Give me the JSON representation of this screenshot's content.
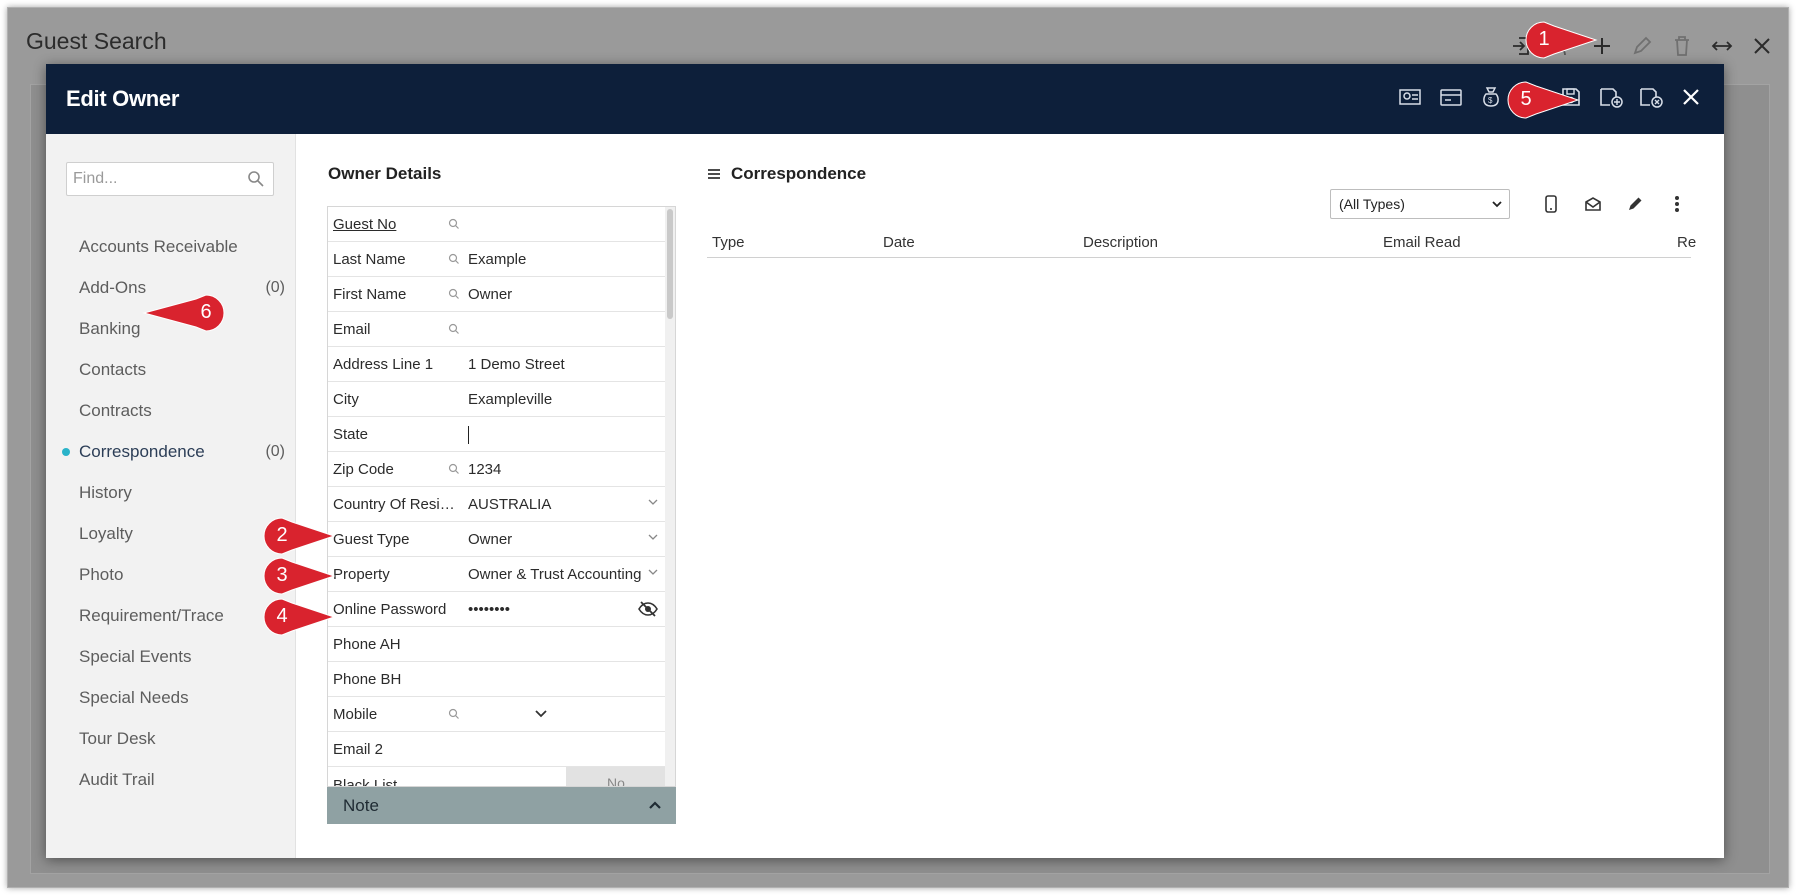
{
  "window": {
    "title": "Guest Search",
    "toolbar_icons": [
      "sign-in-icon",
      "group-icon",
      "plus-icon",
      "pencil-icon",
      "trash-icon",
      "resize-icon",
      "close-icon"
    ]
  },
  "modal": {
    "title": "Edit Owner",
    "header_icons": [
      "guest-icon",
      "card-icon",
      "money-bag-icon",
      "star-icon",
      "save-icon",
      "save-new-icon",
      "save-close-icon",
      "close-icon"
    ]
  },
  "sidebar": {
    "search_placeholder": "Find...",
    "items": [
      {
        "label": "Accounts Receivable",
        "count": ""
      },
      {
        "label": "Add-Ons",
        "count": "(0)"
      },
      {
        "label": "Banking",
        "count": ""
      },
      {
        "label": "Contacts",
        "count": ""
      },
      {
        "label": "Contracts",
        "count": ""
      },
      {
        "label": "Correspondence",
        "count": "(0)"
      },
      {
        "label": "History",
        "count": ""
      },
      {
        "label": "Loyalty",
        "count": ""
      },
      {
        "label": "Photo",
        "count": ""
      },
      {
        "label": "Requirement/Trace",
        "count": ""
      },
      {
        "label": "Special Events",
        "count": ""
      },
      {
        "label": "Special Needs",
        "count": ""
      },
      {
        "label": "Tour Desk",
        "count": ""
      },
      {
        "label": "Audit Trail",
        "count": ""
      }
    ]
  },
  "owner_details": {
    "title": "Owner Details",
    "fields": [
      {
        "label": "Guest No",
        "value": ""
      },
      {
        "label": "Last Name",
        "value": "Example"
      },
      {
        "label": "First Name",
        "value": "Owner"
      },
      {
        "label": "Email",
        "value": ""
      },
      {
        "label": "Address Line 1",
        "value": "1 Demo Street"
      },
      {
        "label": "City",
        "value": "Exampleville"
      },
      {
        "label": "State",
        "value": ""
      },
      {
        "label": "Zip Code",
        "value": "1234"
      },
      {
        "label": "Country Of Reside...",
        "value": "AUSTRALIA"
      },
      {
        "label": "Guest Type",
        "value": "Owner"
      },
      {
        "label": "Property",
        "value": "Owner & Trust Accounting"
      },
      {
        "label": "Online Password",
        "value": "••••••••"
      },
      {
        "label": "Phone AH",
        "value": ""
      },
      {
        "label": "Phone BH",
        "value": ""
      },
      {
        "label": "Mobile",
        "value": ""
      },
      {
        "label": "Email 2",
        "value": ""
      },
      {
        "label": "Black List",
        "value": "No"
      }
    ],
    "note_label": "Note"
  },
  "correspondence": {
    "title": "Correspondence",
    "type_filter": "(All Types)",
    "columns": [
      "Type",
      "Date",
      "Description",
      "Email Read",
      "Re"
    ]
  },
  "callouts": [
    "1",
    "2",
    "3",
    "4",
    "5",
    "6"
  ],
  "colors": {
    "header_bg": "#0d1f3a",
    "callout_red": "#d9232e",
    "active_dot": "#2ab3c9",
    "note_bar": "#8fa1a3"
  }
}
